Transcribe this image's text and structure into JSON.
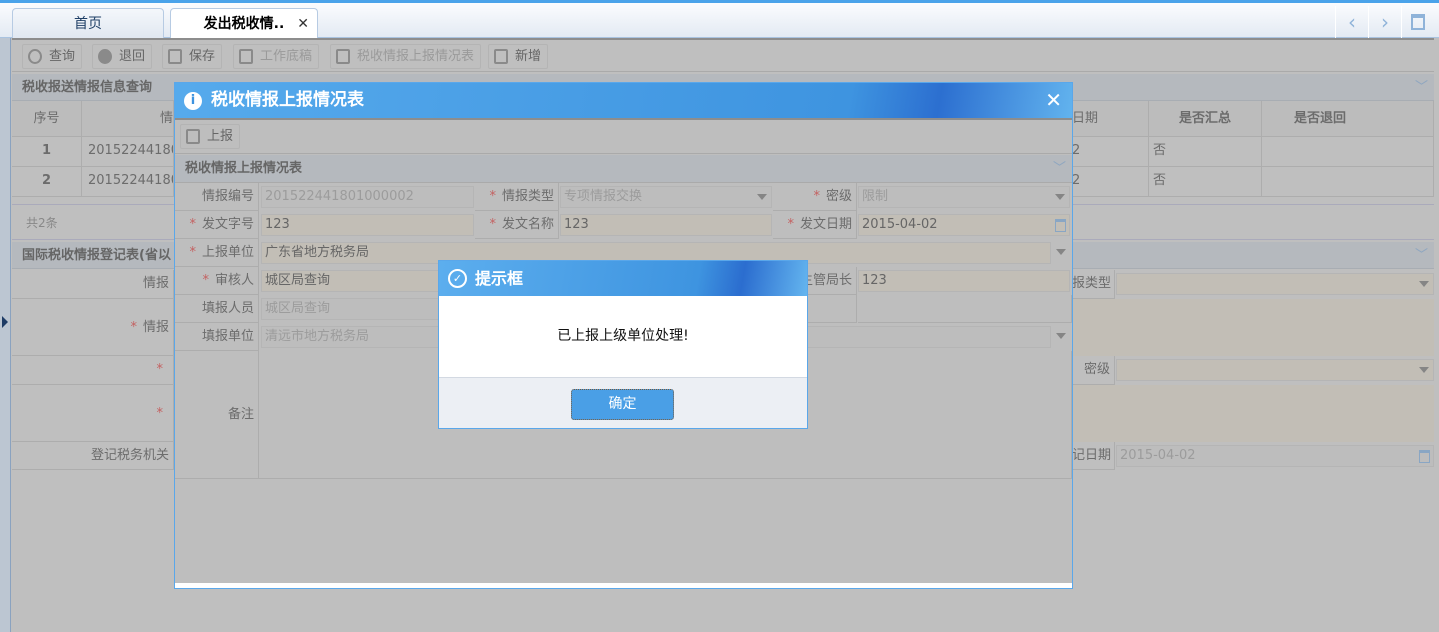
{
  "tabs": [
    {
      "label": "首页"
    },
    {
      "label": "发出税收情.."
    }
  ],
  "tab_close": "✕",
  "nav": {
    "prev": "‹",
    "next": "›"
  },
  "toolbar": [
    {
      "label": "查询",
      "icon": "search-icon"
    },
    {
      "label": "退回",
      "icon": "minus-circle-icon"
    },
    {
      "label": "保存",
      "icon": "save-icon"
    },
    {
      "label": "工作底稿",
      "icon": "doc-add-icon"
    },
    {
      "label": "税收情报上报情况表",
      "icon": "doc-add-icon"
    },
    {
      "label": "新增",
      "icon": "doc-add-icon"
    }
  ],
  "panel1": {
    "title": "税收报送情报信息查询",
    "columns": [
      "序号",
      "情",
      "日期",
      "是否汇总",
      "是否退回"
    ],
    "rows": [
      {
        "no": "1",
        "id": "20152244180",
        "date": "2",
        "summary": "否",
        "returned": ""
      },
      {
        "no": "2",
        "id": "20152244180",
        "date": "2",
        "summary": "否",
        "returned": ""
      }
    ],
    "total": "共2条"
  },
  "panel2": {
    "title": "国际税收情报登记表(省以",
    "labels": [
      "情报",
      "情报",
      "",
      "",
      "登记税务机关"
    ],
    "right_labels": [
      "报类型",
      "密级",
      "记日期"
    ],
    "reg_date": "2015-04-02"
  },
  "dialog": {
    "title": "税收情报上报情况表",
    "close": "✕",
    "report_button": "上报",
    "section_title": "税收情报上报情况表",
    "fields": {
      "intel_no_label": "情报编号",
      "intel_no": "201522441801000002",
      "intel_type_label": "情报类型",
      "intel_type": "专项情报交换",
      "secret_label": "密级",
      "secret": "限制",
      "doc_no_label": "发文字号",
      "doc_no": "123",
      "doc_name_label": "发文名称",
      "doc_name": "123",
      "doc_date_label": "发文日期",
      "doc_date": "2015-04-02",
      "report_unit_label": "上报单位",
      "report_unit": "广东省地方税务局",
      "reviewer_label": "审核人",
      "reviewer": "城区局查询",
      "director_label": "主管局长",
      "director": "123",
      "filler_label": "填报人员",
      "filler": "城区局查询",
      "fill_unit_label": "填报单位",
      "fill_unit": "清远市地方税务局",
      "remark_label": "备注"
    }
  },
  "alert": {
    "title": "提示框",
    "message": "已上报上级单位处理!",
    "ok": "确定"
  },
  "colors": {
    "accent": "#4a9fe6",
    "required": "#c46060"
  }
}
